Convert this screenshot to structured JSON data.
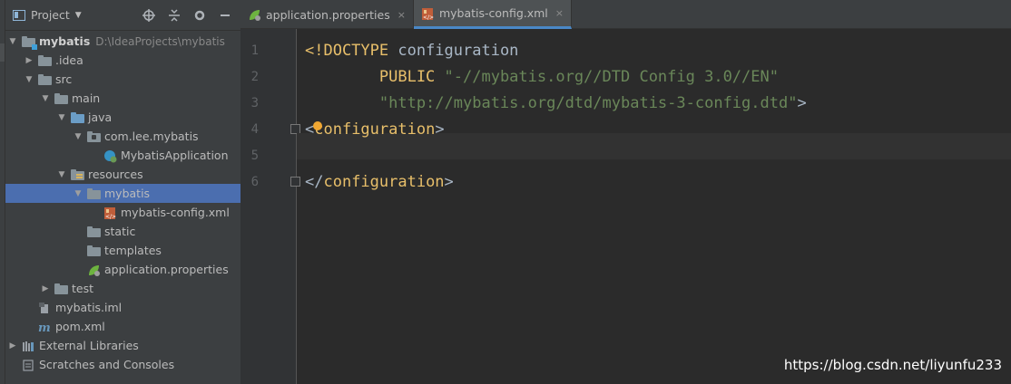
{
  "project_panel": {
    "title": "Project",
    "header_icons": [
      "crosshair-icon",
      "collapse-icon",
      "gear-icon",
      "hide-icon"
    ],
    "tree": [
      {
        "label": "mybatis",
        "path": "D:\\IdeaProjects\\mybatis",
        "level": 0,
        "arrow": "open",
        "icon": "module-folder",
        "bold": true
      },
      {
        "label": ".idea",
        "level": 1,
        "arrow": "closed",
        "icon": "folder"
      },
      {
        "label": "src",
        "level": 1,
        "arrow": "open",
        "icon": "folder"
      },
      {
        "label": "main",
        "level": 2,
        "arrow": "open",
        "icon": "folder"
      },
      {
        "label": "java",
        "level": 3,
        "arrow": "open",
        "icon": "source-folder"
      },
      {
        "label": "com.lee.mybatis",
        "level": 4,
        "arrow": "open",
        "icon": "package"
      },
      {
        "label": "MybatisApplication",
        "level": 5,
        "arrow": "none",
        "icon": "spring-class"
      },
      {
        "label": "resources",
        "level": 3,
        "arrow": "open",
        "icon": "resources-folder"
      },
      {
        "label": "mybatis",
        "level": 4,
        "arrow": "open",
        "icon": "folder",
        "selected": true
      },
      {
        "label": "mybatis-config.xml",
        "level": 5,
        "arrow": "none",
        "icon": "xml-file"
      },
      {
        "label": "static",
        "level": 4,
        "arrow": "none",
        "icon": "folder"
      },
      {
        "label": "templates",
        "level": 4,
        "arrow": "none",
        "icon": "folder"
      },
      {
        "label": "application.properties",
        "level": 4,
        "arrow": "none",
        "icon": "spring-properties"
      },
      {
        "label": "test",
        "level": 2,
        "arrow": "closed",
        "icon": "folder"
      },
      {
        "label": "mybatis.iml",
        "level": 1,
        "arrow": "none",
        "icon": "iml-file"
      },
      {
        "label": "pom.xml",
        "level": 1,
        "arrow": "none",
        "icon": "maven-file"
      },
      {
        "label": "External Libraries",
        "level": 0,
        "arrow": "closed",
        "icon": "libraries"
      },
      {
        "label": "Scratches and Consoles",
        "level": 0,
        "arrow": "none",
        "icon": "scratches"
      }
    ]
  },
  "tabs": [
    {
      "label": "application.properties",
      "icon": "spring-properties",
      "active": false
    },
    {
      "label": "mybatis-config.xml",
      "icon": "xml-file",
      "active": true
    }
  ],
  "tab_close_glyph": "×",
  "editor": {
    "line_numbers": [
      "1",
      "2",
      "3",
      "4",
      "5",
      "6"
    ],
    "lines": [
      {
        "segments": [
          {
            "t": "<!DOCTYPE ",
            "c": "tag"
          },
          {
            "t": "configuration",
            "c": "plain"
          }
        ]
      },
      {
        "segments": [
          {
            "t": "        PUBLIC ",
            "c": "tag"
          },
          {
            "t": "\"-//mybatis.org//DTD Config 3.0//EN\"",
            "c": "str"
          }
        ]
      },
      {
        "segments": [
          {
            "t": "        \"http://mybatis.org/dtd/mybatis-3-config.dtd\"",
            "c": "str"
          },
          {
            "t": ">",
            "c": "plain"
          }
        ]
      },
      {
        "segments": [
          {
            "t": "<",
            "c": "plain"
          },
          {
            "t": "configuration",
            "c": "tag"
          },
          {
            "t": ">",
            "c": "plain"
          }
        ]
      },
      {
        "segments": []
      },
      {
        "segments": [
          {
            "t": "</",
            "c": "plain"
          },
          {
            "t": "configuration",
            "c": "tag"
          },
          {
            "t": ">",
            "c": "plain"
          }
        ]
      }
    ]
  },
  "watermark": "https://blog.csdn.net/liyunfu233",
  "colors": {
    "tag": "#e8bf6a",
    "string": "#6a8759",
    "plain": "#a9b7c6",
    "selection": "#4b6eaf"
  }
}
